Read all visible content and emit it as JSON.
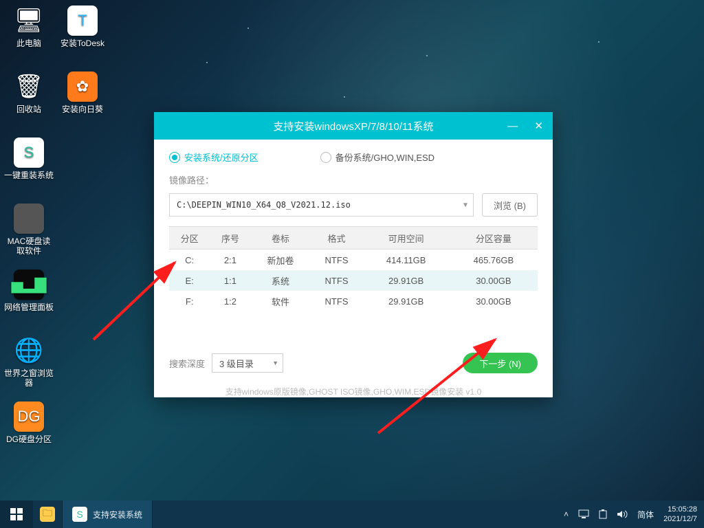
{
  "desktop_icons": [
    {
      "label": "此电脑",
      "glyph": "🖥",
      "bg": "transparent"
    },
    {
      "label": "安装ToDesk",
      "glyph": "T",
      "bg": "#ffffff",
      "fg": "#2fb6ff"
    },
    {
      "label": "回收站",
      "glyph": "🗑",
      "bg": "transparent"
    },
    {
      "label": "安装向日葵",
      "glyph": "✿",
      "bg": "#ff7a1a"
    },
    {
      "label": "一键重装系统",
      "glyph": "S",
      "bg": "#ffffff",
      "fg": "#2bbfa0"
    },
    {
      "label": "MAC硬盘读\n取软件",
      "glyph": "",
      "bg": "#555"
    },
    {
      "label": "网络管理面板",
      "glyph": "▅▂▇",
      "bg": "#0a0a0a",
      "fg": "#38e07b"
    },
    {
      "label": "世界之窗浏览\n器",
      "glyph": "🌐",
      "bg": "transparent"
    },
    {
      "label": "DG硬盘分区",
      "glyph": "DG",
      "bg": "#ff8a1f"
    }
  ],
  "window": {
    "title": "支持安装windowsXP/7/8/10/11系统",
    "mode_install": "安装系统/还原分区",
    "mode_backup": "备份系统/GHO,WIN,ESD",
    "path_label": "镜像路径：",
    "path_value": "C:\\DEEPIN_WIN10_X64_Q8_V2021.12.iso",
    "browse": "浏览 (B)",
    "headers": [
      "分区",
      "序号",
      "卷标",
      "格式",
      "可用空间",
      "分区容量"
    ],
    "rows": [
      {
        "drive": "C:",
        "idx": "2:1",
        "label": "新加卷",
        "fs": "NTFS",
        "free": "414.11GB",
        "total": "465.76GB",
        "sel": false
      },
      {
        "drive": "E:",
        "idx": "1:1",
        "label": "系统",
        "fs": "NTFS",
        "free": "29.91GB",
        "total": "30.00GB",
        "sel": true
      },
      {
        "drive": "F:",
        "idx": "1:2",
        "label": "软件",
        "fs": "NTFS",
        "free": "29.91GB",
        "total": "30.00GB",
        "sel": false
      }
    ],
    "depth_label": "搜索深度",
    "depth_value": "3 级目录",
    "next": "下一步 (N)",
    "footer": "支持windows原版镜像,GHOST ISO镜像,GHO,WIM,ESD镜像安装   v1.0"
  },
  "taskbar": {
    "app": "支持安装系统",
    "ime": "简体",
    "time": "15:05:28",
    "date": "2021/12/7"
  }
}
